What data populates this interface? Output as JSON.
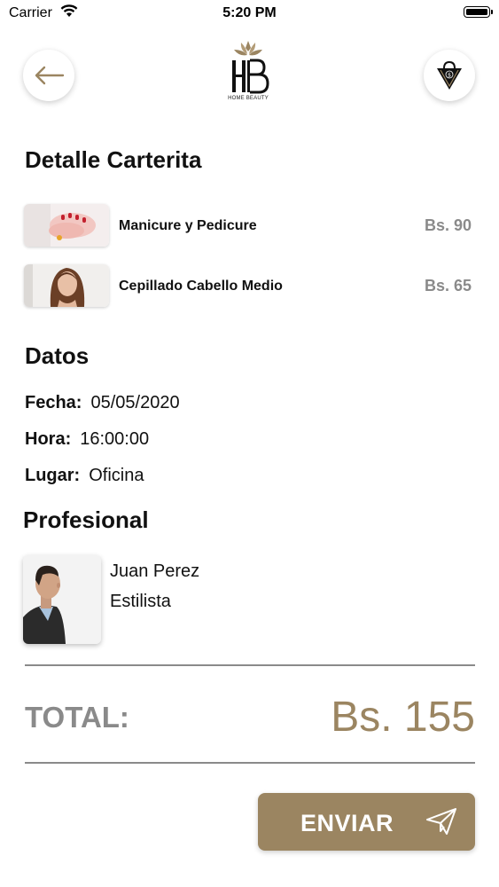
{
  "status_bar": {
    "carrier": "Carrier",
    "time": "5:20 PM"
  },
  "header": {
    "back_icon": "arrow-left-icon",
    "cart_icon": "shopping-bag-icon",
    "logo_monogram": "HB",
    "logo_caption": "HOME BEAUTY"
  },
  "detalle": {
    "title": "Detalle Carterita",
    "items": [
      {
        "name": "Manicure y Pedicure",
        "price": "Bs. 90"
      },
      {
        "name": "Cepillado Cabello Medio",
        "price": "Bs. 65"
      }
    ]
  },
  "datos": {
    "title": "Datos",
    "fecha_label": "Fecha:",
    "fecha_value": "05/05/2020",
    "hora_label": "Hora:",
    "hora_value": "16:00:00",
    "lugar_label": "Lugar:",
    "lugar_value": "Oficina"
  },
  "profesional": {
    "title": "Profesional",
    "name": "Juan Perez",
    "role": "Estilista"
  },
  "total": {
    "label": "TOTAL:",
    "value": "Bs. 155"
  },
  "send_button": {
    "label": "ENVIAR",
    "icon": "paper-plane-icon"
  },
  "colors": {
    "accent": "#9b8561",
    "muted": "#8a8a8a"
  }
}
